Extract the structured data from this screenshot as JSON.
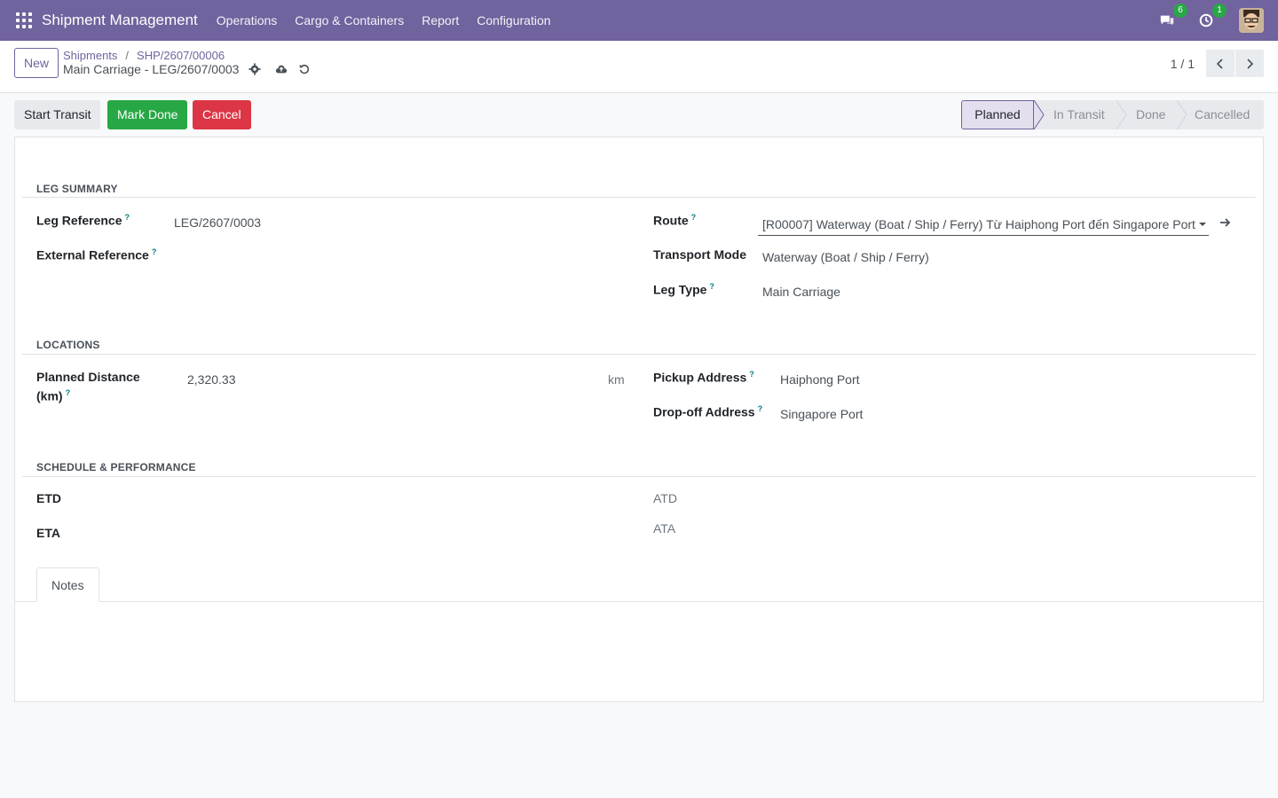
{
  "navbar": {
    "brand": "Shipment Management",
    "menu": [
      "Operations",
      "Cargo & Containers",
      "Report",
      "Configuration"
    ],
    "messages_count": "6",
    "activities_count": "1"
  },
  "control_panel": {
    "new_label": "New",
    "breadcrumb": [
      "Shipments",
      "SHP/2607/00006"
    ],
    "record_title": "Main Carriage - LEG/2607/0003",
    "pager": "1 / 1"
  },
  "statusbar": {
    "buttons": {
      "start_transit": "Start Transit",
      "mark_done": "Mark Done",
      "cancel": "Cancel"
    },
    "stages": [
      "Planned",
      "In Transit",
      "Done",
      "Cancelled"
    ],
    "current_stage": "Planned"
  },
  "form": {
    "leg_summary": {
      "title": "LEG SUMMARY",
      "leg_reference_label": "Leg Reference",
      "leg_reference_value": "LEG/2607/0003",
      "external_reference_label": "External Reference",
      "route_label": "Route",
      "route_value": "[R00007] Waterway (Boat / Ship / Ferry) Từ Haiphong Port đến Singapore Port (",
      "transport_mode_label": "Transport Mode",
      "transport_mode_value": "Waterway (Boat / Ship / Ferry)",
      "leg_type_label": "Leg Type",
      "leg_type_value": "Main Carriage"
    },
    "locations": {
      "title": "LOCATIONS",
      "planned_distance_label_1": "Planned Distance",
      "planned_distance_label_2": "(km)",
      "planned_distance_value": "2,320.33",
      "distance_unit": "km",
      "pickup_label": "Pickup Address",
      "pickup_value": "Haiphong Port",
      "dropoff_label": "Drop-off Address",
      "dropoff_value": "Singapore Port"
    },
    "schedule": {
      "title": "SCHEDULE & PERFORMANCE",
      "etd_label": "ETD",
      "eta_label": "ETA",
      "atd_label": "ATD",
      "ata_label": "ATA"
    },
    "tabs": [
      "Notes"
    ],
    "help_mark": "?"
  },
  "colors": {
    "brand": "#71639e",
    "success": "#28a745",
    "danger": "#dc3545",
    "help": "#017e84"
  }
}
